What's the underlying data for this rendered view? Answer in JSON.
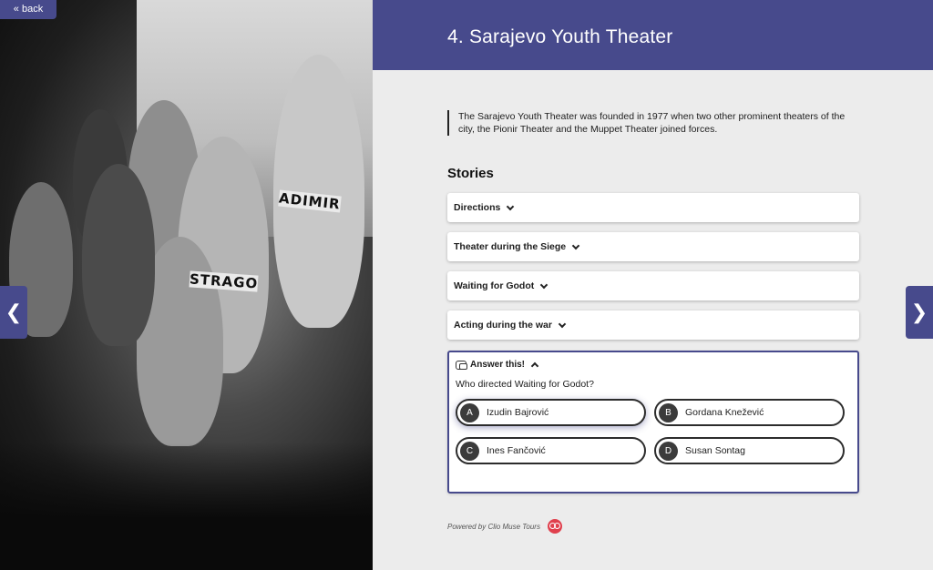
{
  "nav": {
    "back_label": "« back",
    "prev_label": "❮",
    "next_label": "❯"
  },
  "photo": {
    "signs": [
      "ADIMIR",
      "STRAGO"
    ]
  },
  "header": {
    "title": "4. Sarajevo Youth Theater"
  },
  "intro": {
    "text": "The Sarajevo Youth Theater was founded in 1977 when two other prominent theaters of the city, the Pionir Theater and the Muppet Theater joined forces."
  },
  "stories": {
    "title": "Stories",
    "items": [
      {
        "label": "Directions"
      },
      {
        "label": "Theater during the Siege"
      },
      {
        "label": "Waiting for Godot"
      },
      {
        "label": "Acting during the war"
      }
    ]
  },
  "quiz": {
    "header": "Answer this!",
    "question": "Who directed Waiting for Godot?",
    "answers": [
      {
        "letter": "A",
        "text": "Izudin Bajrović"
      },
      {
        "letter": "B",
        "text": "Gordana Knežević"
      },
      {
        "letter": "C",
        "text": "Ines Fančović"
      },
      {
        "letter": "D",
        "text": "Susan Sontag"
      }
    ]
  },
  "footer": {
    "powered_by": "Powered by Clio Muse Tours"
  },
  "colors": {
    "accent": "#474a8c",
    "logo": "#e0404d",
    "background": "#ececec"
  }
}
